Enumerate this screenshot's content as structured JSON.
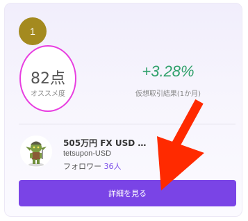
{
  "card": {
    "rank": "1",
    "score": {
      "value": "82点",
      "caption": "オススメ度"
    },
    "return": {
      "value": "+3.28%",
      "caption": "仮想取引結果(1か月)"
    },
    "plan": {
      "name": "505万円 FX USD …",
      "user_id": "tetsupon-USD",
      "followers_label": "フォロワー",
      "followers_count": "36人"
    },
    "detail_button": "詳細を見る"
  },
  "colors": {
    "rank_badge": "#a48a1f",
    "score_ring": "#e83ee0",
    "return_positive": "#2fa06a",
    "button": "#7a44e6",
    "arrow": "#ff2a00"
  },
  "icons": {
    "avatar": "goblin-character-avatar",
    "annotation": "red-arrow-pointer"
  }
}
